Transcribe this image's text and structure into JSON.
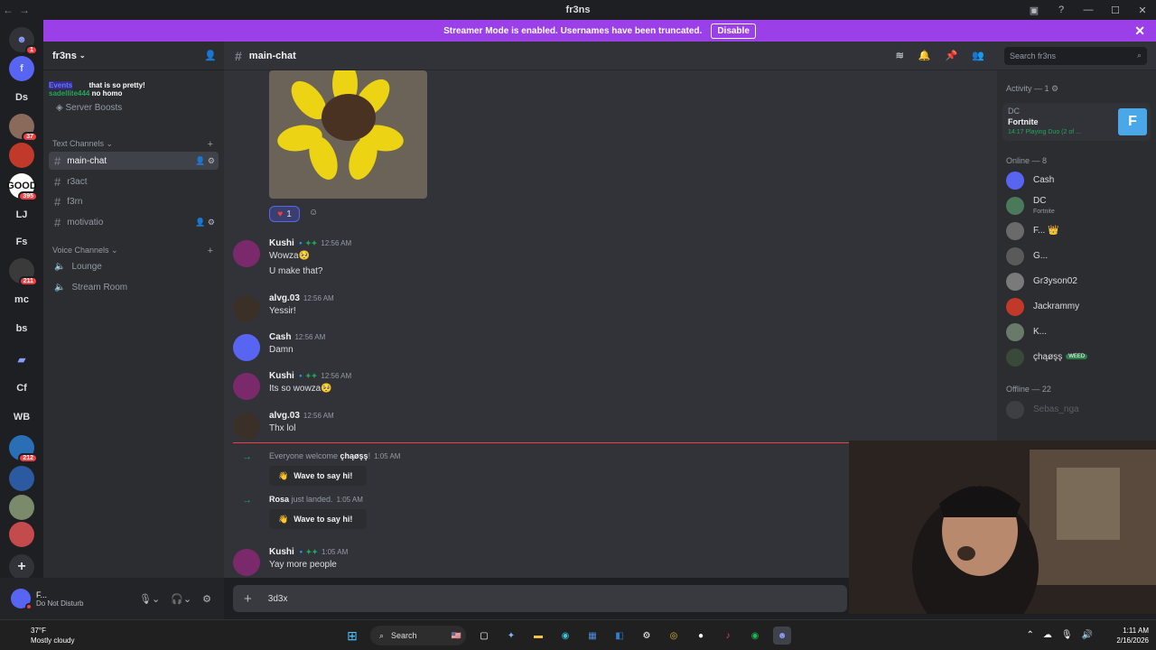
{
  "window": {
    "title": "fr3ns"
  },
  "banner": {
    "text": "Streamer Mode is enabled. Usernames have been truncated.",
    "disable_label": "Disable"
  },
  "guilds": [
    {
      "label": "",
      "badge": "1",
      "icon": "discord-home-icon",
      "color": "#313338"
    },
    {
      "label": "f",
      "badge": "",
      "icon": "",
      "color": "#5865f2"
    },
    {
      "label": "Ds",
      "badge": "",
      "icon": "",
      "color": "#1e1f22"
    },
    {
      "label": "",
      "badge": "37",
      "icon": "",
      "color": "#8a6a5a"
    },
    {
      "label": "",
      "badge": "",
      "icon": "",
      "color": "#c0392b"
    },
    {
      "label": "GOOD",
      "badge": "395",
      "icon": "",
      "color": "#ffffff"
    },
    {
      "label": "LJ",
      "badge": "",
      "icon": "",
      "color": "#1e1f22"
    },
    {
      "label": "Fs",
      "badge": "",
      "icon": "",
      "color": "#1e1f22"
    },
    {
      "label": "",
      "badge": "211",
      "icon": "",
      "color": "#3a3a3a"
    },
    {
      "label": "mc",
      "badge": "",
      "icon": "",
      "color": "#1e1f22"
    },
    {
      "label": "bs",
      "badge": "",
      "icon": "",
      "color": "#1e1f22"
    },
    {
      "label": "",
      "badge": "",
      "icon": "folder-icon",
      "color": "#1e1f22"
    },
    {
      "label": "Cf",
      "badge": "",
      "icon": "",
      "color": "#1e1f22"
    },
    {
      "label": "WB",
      "badge": "",
      "icon": "",
      "color": "#1e1f22"
    },
    {
      "label": "",
      "badge": "212",
      "icon": "",
      "color": "#2a6fb5"
    },
    {
      "label": "",
      "badge": "",
      "icon": "",
      "color": "#2c5aa0"
    },
    {
      "label": "",
      "badge": "",
      "icon": "",
      "color": "#7a8a6a"
    },
    {
      "label": "",
      "badge": "",
      "icon": "",
      "color": "#c44b4b"
    }
  ],
  "server": {
    "name": "fr3ns",
    "boosts": "Server Boosts",
    "overlay_events": "Events",
    "overlay_msg1": "that is so pretty!",
    "overlay_user2": "sadellite444",
    "overlay_msg2": "no homo"
  },
  "text_category": "Text Channels",
  "text_channels": [
    {
      "name": "main-chat",
      "active": true
    },
    {
      "name": "r3act",
      "active": false
    },
    {
      "name": "f3rn",
      "active": false
    },
    {
      "name": "motivatio",
      "active": false
    }
  ],
  "voice_category": "Voice Channels",
  "voice_channels": [
    {
      "name": "Lounge"
    },
    {
      "name": "Stream Room"
    }
  ],
  "user_panel": {
    "name": "F...",
    "status": "Do Not Disturb"
  },
  "chat": {
    "channel": "main-chat",
    "search_placeholder": "Search fr3ns",
    "reaction_count": "1",
    "messages": [
      {
        "user": "Kushi",
        "time": "12:56 AM",
        "lines": [
          "Wowza🥺",
          "U make that?"
        ],
        "color": "#7a2a6a"
      },
      {
        "user": "alvg.03",
        "time": "12:56 AM",
        "lines": [
          "Yessir!"
        ],
        "color": "#3a3028"
      },
      {
        "user": "Cash",
        "time": "12:56 AM",
        "lines": [
          "Damn"
        ],
        "color": "#5865f2"
      },
      {
        "user": "Kushi",
        "time": "12:56 AM",
        "lines": [
          "Its so wowza🥺"
        ],
        "color": "#7a2a6a"
      },
      {
        "user": "alvg.03",
        "time": "12:56 AM",
        "lines": [
          "Thx lol"
        ],
        "color": "#3a3028"
      }
    ],
    "system": [
      {
        "prefix": "Everyone welcome ",
        "name": "çhąøşş",
        "suffix": "!",
        "time": "1:05 AM",
        "wave": "Wave to say hi!"
      },
      {
        "prefix": "",
        "name": "Rosa",
        "suffix": " just landed.",
        "time": "1:05 AM",
        "wave": "Wave to say hi!"
      }
    ],
    "last_message": {
      "user": "Kushi",
      "time": "1:05 AM",
      "text": "Yay more people",
      "color": "#7a2a6a"
    },
    "composer_text": "3d3x"
  },
  "members": {
    "activity_header": "Activity — 1",
    "activity": {
      "user": "DC",
      "game": "Fortnite",
      "meta": "14:17  Playing Duo (2 of ..."
    },
    "online_header": "Online — 8",
    "online": [
      {
        "name": "Cash",
        "sub": "",
        "color": "#5865f2"
      },
      {
        "name": "DC",
        "sub": "Fortnite",
        "color": "#4a7a5a"
      },
      {
        "name": "F... 👑",
        "sub": "",
        "color": "#6a6a6a"
      },
      {
        "name": "G...",
        "sub": "",
        "color": "#5a5a5a"
      },
      {
        "name": "Gr3yson02",
        "sub": "",
        "color": "#7a7a7a"
      },
      {
        "name": "Jackrammy",
        "sub": "",
        "color": "#c0392b"
      },
      {
        "name": "K...",
        "sub": "",
        "color": "#6a7a6a"
      },
      {
        "name": "çhąøşş",
        "sub": "",
        "color": "#3a4a3a",
        "tag": "WEED"
      }
    ],
    "offline_header": "Offline — 22",
    "offline": [
      {
        "name": "Sebas_nga",
        "color": "#5a5a5a"
      }
    ]
  },
  "taskbar": {
    "temp": "37°F",
    "weather": "Mostly cloudy",
    "search": "Search",
    "time": "1:11 AM",
    "date": "2/16/2026"
  }
}
